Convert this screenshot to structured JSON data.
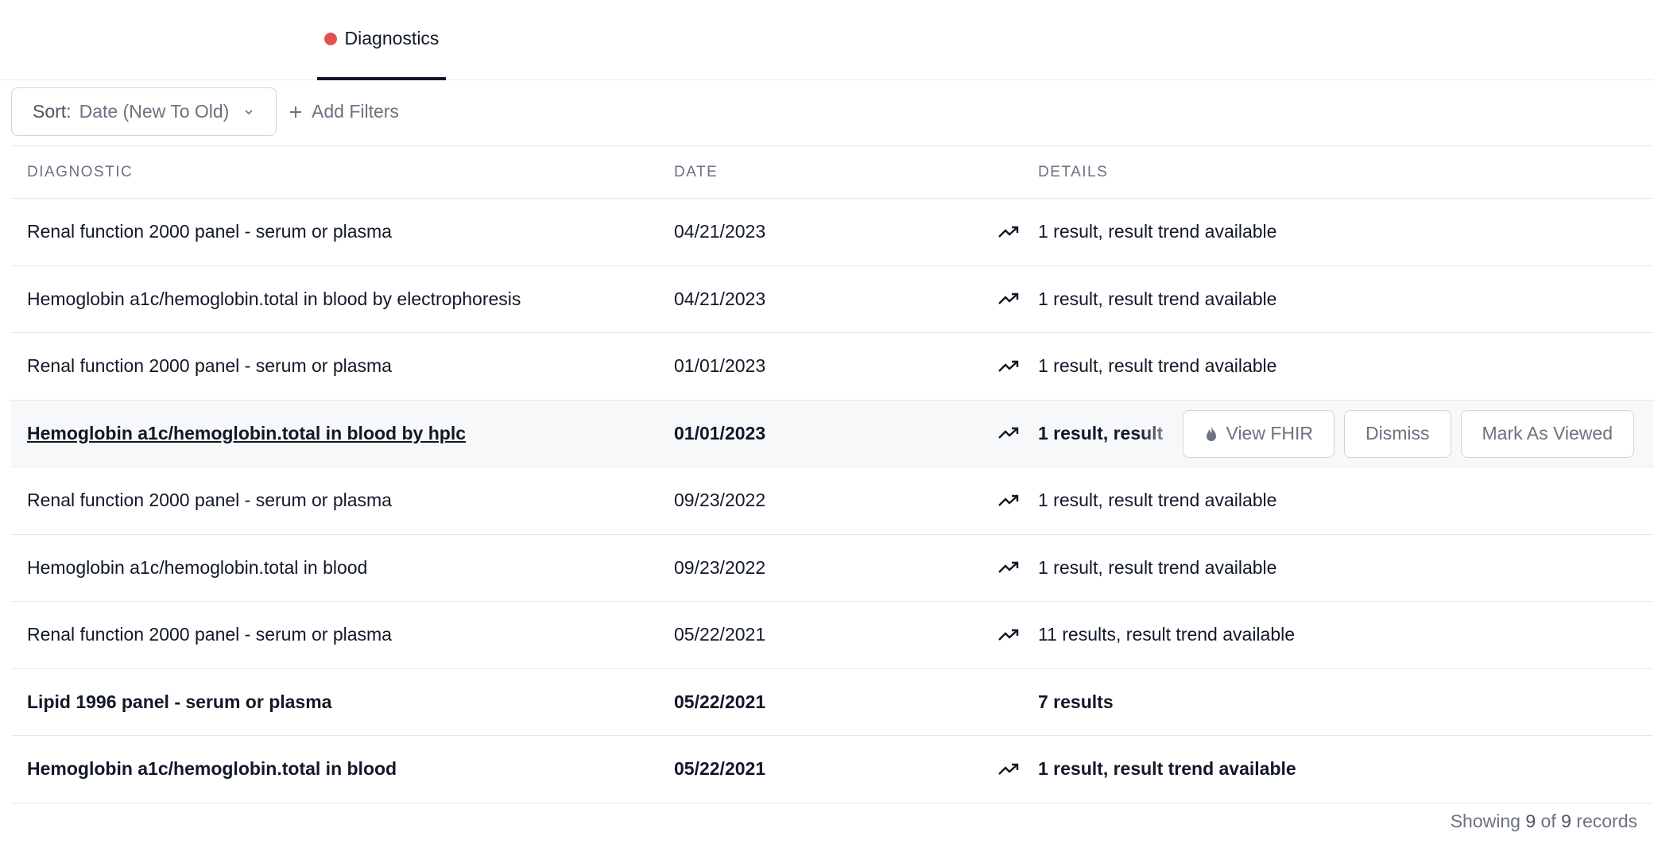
{
  "tabs": [
    {
      "label": "Diagnostics",
      "status_color": "#e05252"
    }
  ],
  "toolbar": {
    "sort_key": "Sort:",
    "sort_value": "Date (New To Old)",
    "add_filters": "Add Filters"
  },
  "table": {
    "headers": {
      "diagnostic": "DIAGNOSTIC",
      "date": "DATE",
      "details": "DETAILS"
    },
    "rows": [
      {
        "diagnostic": "Renal function 2000 panel - serum or plasma",
        "date": "04/21/2023",
        "details": "1 result, result trend available",
        "trend": true
      },
      {
        "diagnostic": "Hemoglobin a1c/hemoglobin.total in blood by electrophoresis",
        "date": "04/21/2023",
        "details": "1 result, result trend available",
        "trend": true
      },
      {
        "diagnostic": "Renal function 2000 panel - serum or plasma",
        "date": "01/01/2023",
        "details": "1 result, result trend available",
        "trend": true
      },
      {
        "diagnostic": "Hemoglobin a1c/hemoglobin.total in blood by hplc",
        "date": "01/01/2023",
        "details": "1 result, result t",
        "trend": true
      },
      {
        "diagnostic": "Renal function 2000 panel - serum or plasma",
        "date": "09/23/2022",
        "details": "1 result, result trend available",
        "trend": true
      },
      {
        "diagnostic": "Hemoglobin a1c/hemoglobin.total in blood",
        "date": "09/23/2022",
        "details": "1 result, result trend available",
        "trend": true
      },
      {
        "diagnostic": "Renal function 2000 panel - serum or plasma",
        "date": "05/22/2021",
        "details": "11 results, result trend available",
        "trend": true
      },
      {
        "diagnostic": "Lipid 1996 panel - serum or plasma",
        "date": "05/22/2021",
        "details": "7 results",
        "trend": false
      },
      {
        "diagnostic": "Hemoglobin a1c/hemoglobin.total in blood",
        "date": "05/22/2021",
        "details": "1 result, result trend available",
        "trend": true
      }
    ]
  },
  "row_actions": {
    "view_fhir": "View FHIR",
    "dismiss": "Dismiss",
    "mark_as_viewed": "Mark As Viewed"
  },
  "footer": {
    "prefix": "Showing",
    "shown": "9",
    "of": "of",
    "total": "9",
    "suffix": "records"
  },
  "icons": {
    "trend": "trending-up-icon",
    "fhir": "flame-icon",
    "sort": "chevron-down-icon",
    "filter": "plus-icon"
  }
}
